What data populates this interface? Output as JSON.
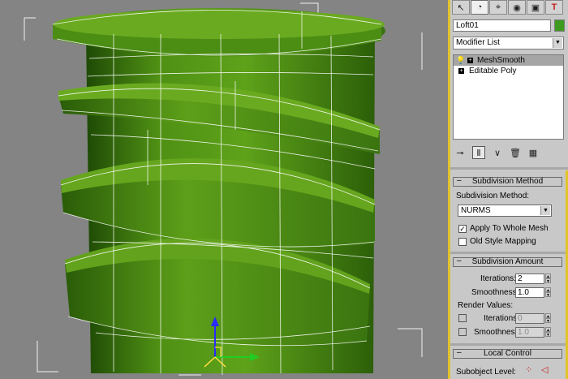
{
  "viewport": {
    "object_color": "#4d8a12",
    "wire_color": "#ffffff",
    "background": "#848484"
  },
  "toolbar": {
    "buttons": [
      {
        "icon": "create-icon",
        "glyph": "↖"
      },
      {
        "icon": "modify-icon",
        "glyph": "◔"
      },
      {
        "icon": "hierarchy-icon",
        "glyph": "⌖"
      },
      {
        "icon": "motion-icon",
        "glyph": "◉"
      },
      {
        "icon": "display-icon",
        "glyph": "▣"
      },
      {
        "icon": "utilities-icon",
        "glyph": "T"
      }
    ]
  },
  "object": {
    "name": "Loft01",
    "color": "#3e9a1f"
  },
  "modifier_list": {
    "label": "Modifier List"
  },
  "stack": {
    "items": [
      {
        "label": "MeshSmooth",
        "selected": true
      },
      {
        "label": "Editable Poly",
        "selected": false
      }
    ]
  },
  "subdivision_method": {
    "title": "Subdivision Method",
    "field_label": "Subdivision Method:",
    "value": "NURMS",
    "apply_whole_mesh": {
      "label": "Apply To Whole Mesh",
      "checked": true
    },
    "old_style_mapping": {
      "label": "Old Style Mapping",
      "checked": false
    }
  },
  "subdivision_amount": {
    "title": "Subdivision Amount",
    "iterations_label": "Iterations:",
    "iterations": "2",
    "smoothness_label": "Smoothness:",
    "smoothness": "1.0",
    "render_values_label": "Render Values:",
    "render_iterations_label": "Iterations:",
    "render_iterations": "0",
    "render_smoothness_label": "Smoothness:",
    "render_smoothness": "1.0"
  },
  "local_control": {
    "title": "Local Control",
    "subobject_label": "Subobject Level:"
  }
}
